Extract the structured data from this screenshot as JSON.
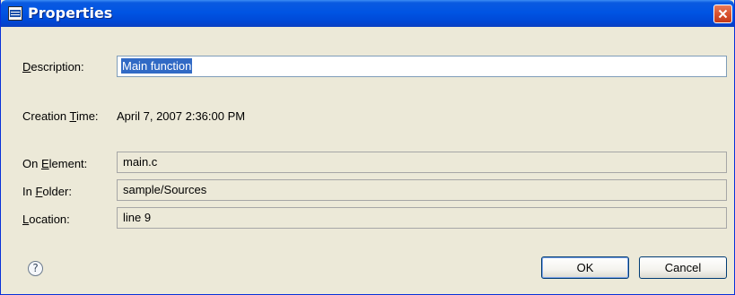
{
  "window": {
    "title": "Properties",
    "icon": "todo-task-icon"
  },
  "fields": {
    "description": {
      "label_pre": "",
      "label_mnemonic": "D",
      "label_post": "escription:",
      "value": "Main function"
    },
    "creation_time": {
      "label_pre": "Creation ",
      "label_mnemonic": "T",
      "label_post": "ime:",
      "value": "April 7, 2007 2:36:00 PM"
    },
    "on_element": {
      "label_pre": "On ",
      "label_mnemonic": "E",
      "label_post": "lement:",
      "value": "main.c"
    },
    "in_folder": {
      "label_pre": "In ",
      "label_mnemonic": "F",
      "label_post": "older:",
      "value": "sample/Sources"
    },
    "location": {
      "label_pre": "",
      "label_mnemonic": "L",
      "label_post": "ocation:",
      "value": "line 9"
    }
  },
  "buttons": {
    "ok": "OK",
    "cancel": "Cancel",
    "help": "?"
  },
  "colors": {
    "titlebar": "#0054e3",
    "dialog_bg": "#ece9d8",
    "selection": "#316ac5"
  }
}
